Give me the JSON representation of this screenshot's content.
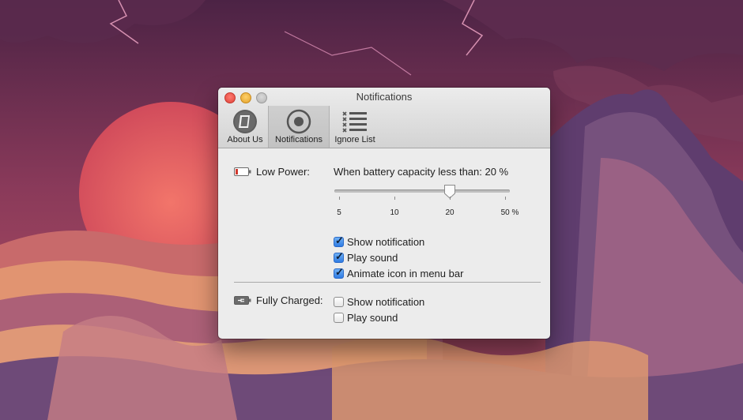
{
  "window": {
    "title": "Notifications"
  },
  "toolbar": {
    "items": [
      {
        "label": "About Us",
        "icon": "info-shield-icon",
        "selected": false
      },
      {
        "label": "Notifications",
        "icon": "record-circle-icon",
        "selected": true
      },
      {
        "label": "Ignore List",
        "icon": "x-list-icon",
        "selected": false
      }
    ]
  },
  "low_power": {
    "label": "Low Power:",
    "icon": "battery-low-icon",
    "capacity_text": "When battery capacity less than: 20 %",
    "slider": {
      "value": 20,
      "ticks": [
        "5",
        "10",
        "20",
        "50 %"
      ]
    },
    "options": [
      {
        "label": "Show notification",
        "checked": true
      },
      {
        "label": "Play sound",
        "checked": true
      },
      {
        "label": "Animate icon in menu bar",
        "checked": true
      }
    ]
  },
  "fully_charged": {
    "label": "Fully Charged:",
    "icon": "battery-charging-icon",
    "options": [
      {
        "label": "Show notification",
        "checked": false
      },
      {
        "label": "Play sound",
        "checked": false
      }
    ]
  },
  "colors": {
    "accent_checkbox": "#2f7ce3",
    "battery_low": "#d0392e",
    "window_bg": "#ececec"
  }
}
